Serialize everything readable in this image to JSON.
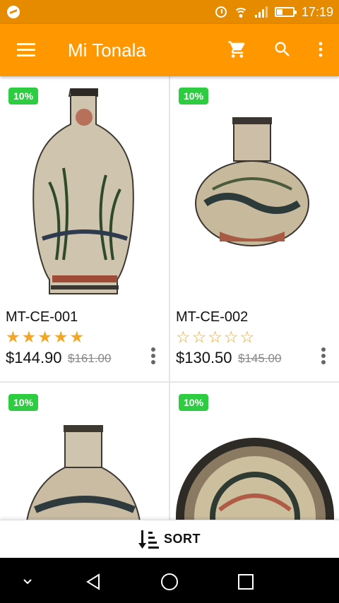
{
  "statusbar": {
    "time": "17:19",
    "icons": [
      "messenger-icon",
      "alarm-icon",
      "wifi-icon",
      "signal-icon",
      "battery-icon"
    ]
  },
  "toolbar": {
    "title": "Mi Tonala",
    "menu_icon": "hamburger-menu-icon",
    "cart_icon": "shopping-cart-icon",
    "search_icon": "search-icon",
    "overflow_icon": "more-vertical-icon",
    "color": "#ff9800"
  },
  "products": [
    {
      "badge": "10%",
      "sku": "MT-CE-001",
      "rating": 5,
      "price": "$144.90",
      "old_price": "$161.00"
    },
    {
      "badge": "10%",
      "sku": "MT-CE-002",
      "rating": 0,
      "price": "$130.50",
      "old_price": "$145.00"
    },
    {
      "badge": "10%"
    },
    {
      "badge": "10%"
    }
  ],
  "sort": {
    "label": "SORT",
    "icon": "sort-icon"
  },
  "colors": {
    "accent": "#ff9800",
    "badge": "#2ecc40",
    "star": "#f5a623"
  }
}
